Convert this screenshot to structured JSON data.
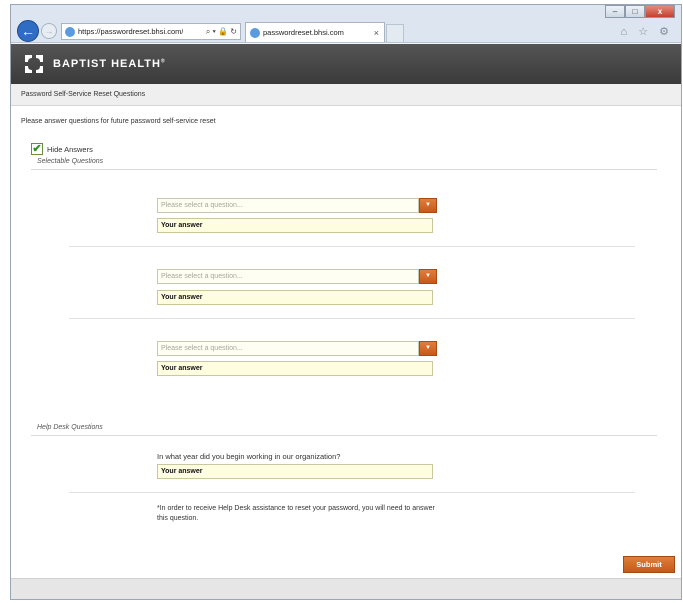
{
  "browser": {
    "url": "https://passwordreset.bhsi.com/",
    "address_icons": "⌕ ▾ 🔒 ↻",
    "tab_title": "passwordreset.bhsi.com",
    "tab_close": "×",
    "back_glyph": "←",
    "forward_glyph": "→",
    "tool_icons": "⌂ ☆ ⚙",
    "window_controls": {
      "minimize": "–",
      "maximize": "□",
      "close": "x"
    }
  },
  "brand": {
    "name": "BAPTIST HEALTH",
    "trademark": "®",
    "accent": "#d26a28",
    "banner_color": "#444444"
  },
  "page_title": "Password Self-Service Reset Questions",
  "instructions": "Please answer questions for future password self-service reset",
  "hide_answers": {
    "label": "Hide Answers",
    "checked_glyph": "✔"
  },
  "selectable": {
    "label": "Selectable Questions",
    "questions": [
      {
        "placeholder": "Please select a question...",
        "answer": "Your answer"
      },
      {
        "placeholder": "Please select a question...",
        "answer": "Your answer"
      },
      {
        "placeholder": "Please select a question...",
        "answer": "Your answer"
      }
    ],
    "dropdown_glyph": "▼"
  },
  "helpdesk": {
    "label": "Help Desk Questions",
    "question": "In what year did you begin working in our organization?",
    "answer": "Your answer",
    "note": "*In order to receive Help Desk assistance to reset your password, you will need to answer this question."
  },
  "submit_label": "Submit"
}
